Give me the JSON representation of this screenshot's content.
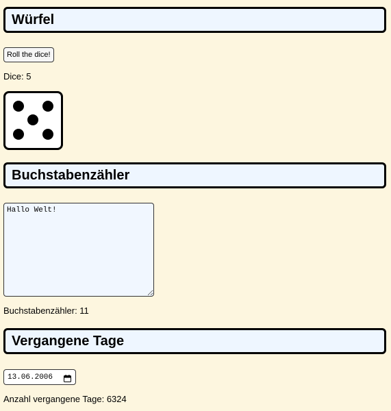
{
  "dice_section": {
    "title": "Würfel",
    "roll_button_label": "Roll the dice!",
    "result_text": "Dice: 5",
    "die_value": 5
  },
  "letter_section": {
    "title": "Buchstabenzähler",
    "textarea_value": "Hallo Welt!",
    "count_text": "Buchstabenzähler: 11"
  },
  "days_section": {
    "title": "Vergangene Tage",
    "date_value": "13.06.2006",
    "result_text": "Anzahl vergangene Tage: 6324"
  },
  "icons": {
    "calendar": "calendar-icon"
  },
  "colors": {
    "page_background": "#fdf6df",
    "header_background": "#eef6ff",
    "textarea_background": "#f1f7ff"
  }
}
